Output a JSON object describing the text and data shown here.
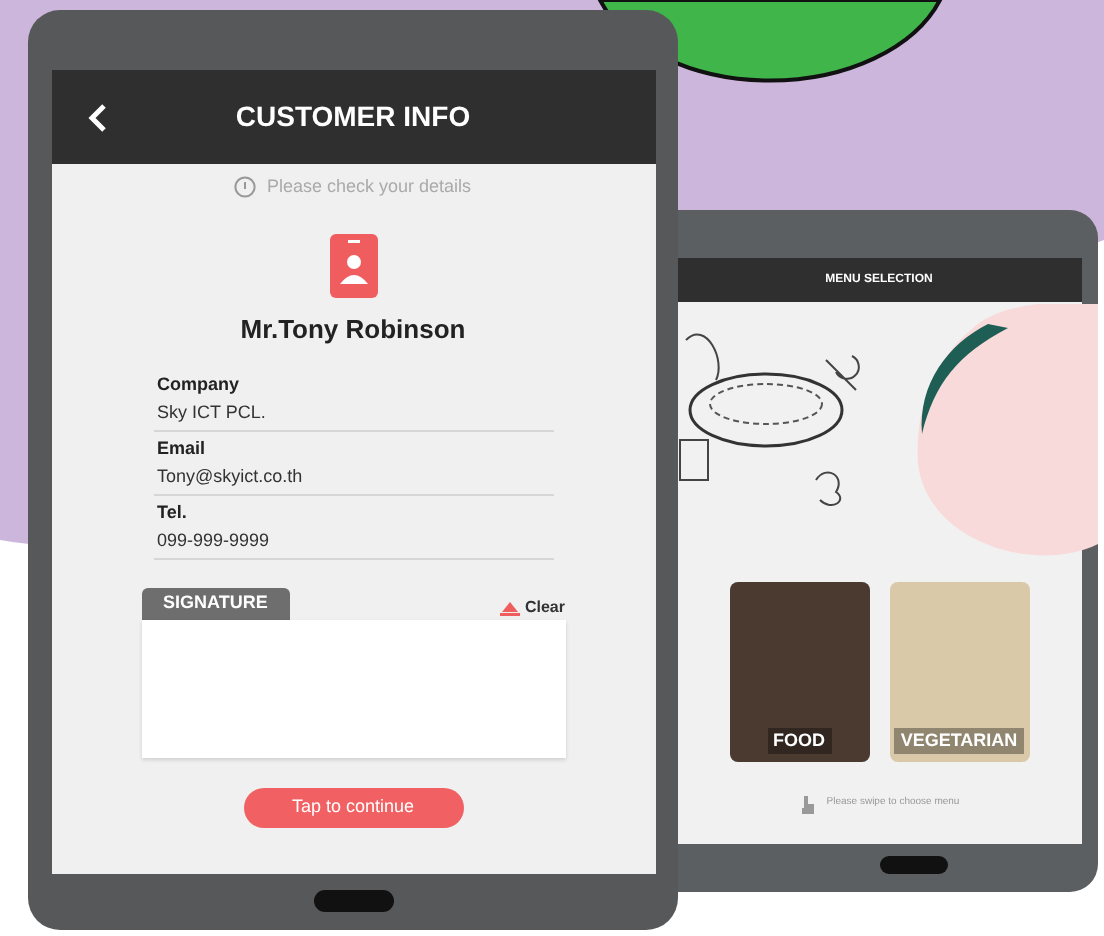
{
  "customer_screen": {
    "title": "CUSTOMER INFO",
    "notice": "Please check your details",
    "name": "Mr.Tony Robinson",
    "fields": [
      {
        "label": "Company",
        "value": "Sky ICT PCL."
      },
      {
        "label": "Email",
        "value": "Tony@skyict.co.th"
      },
      {
        "label": "Tel.",
        "value": "099-999-9999"
      }
    ],
    "signature": {
      "label": "SIGNATURE",
      "clear": "Clear"
    },
    "button": "Tap to continue"
  },
  "menu_screen": {
    "title": "MENU SELECTION",
    "cards": [
      {
        "label": "FOOD"
      },
      {
        "label": "VEGETARIAN"
      }
    ],
    "hint": "Please swipe to choose menu"
  }
}
